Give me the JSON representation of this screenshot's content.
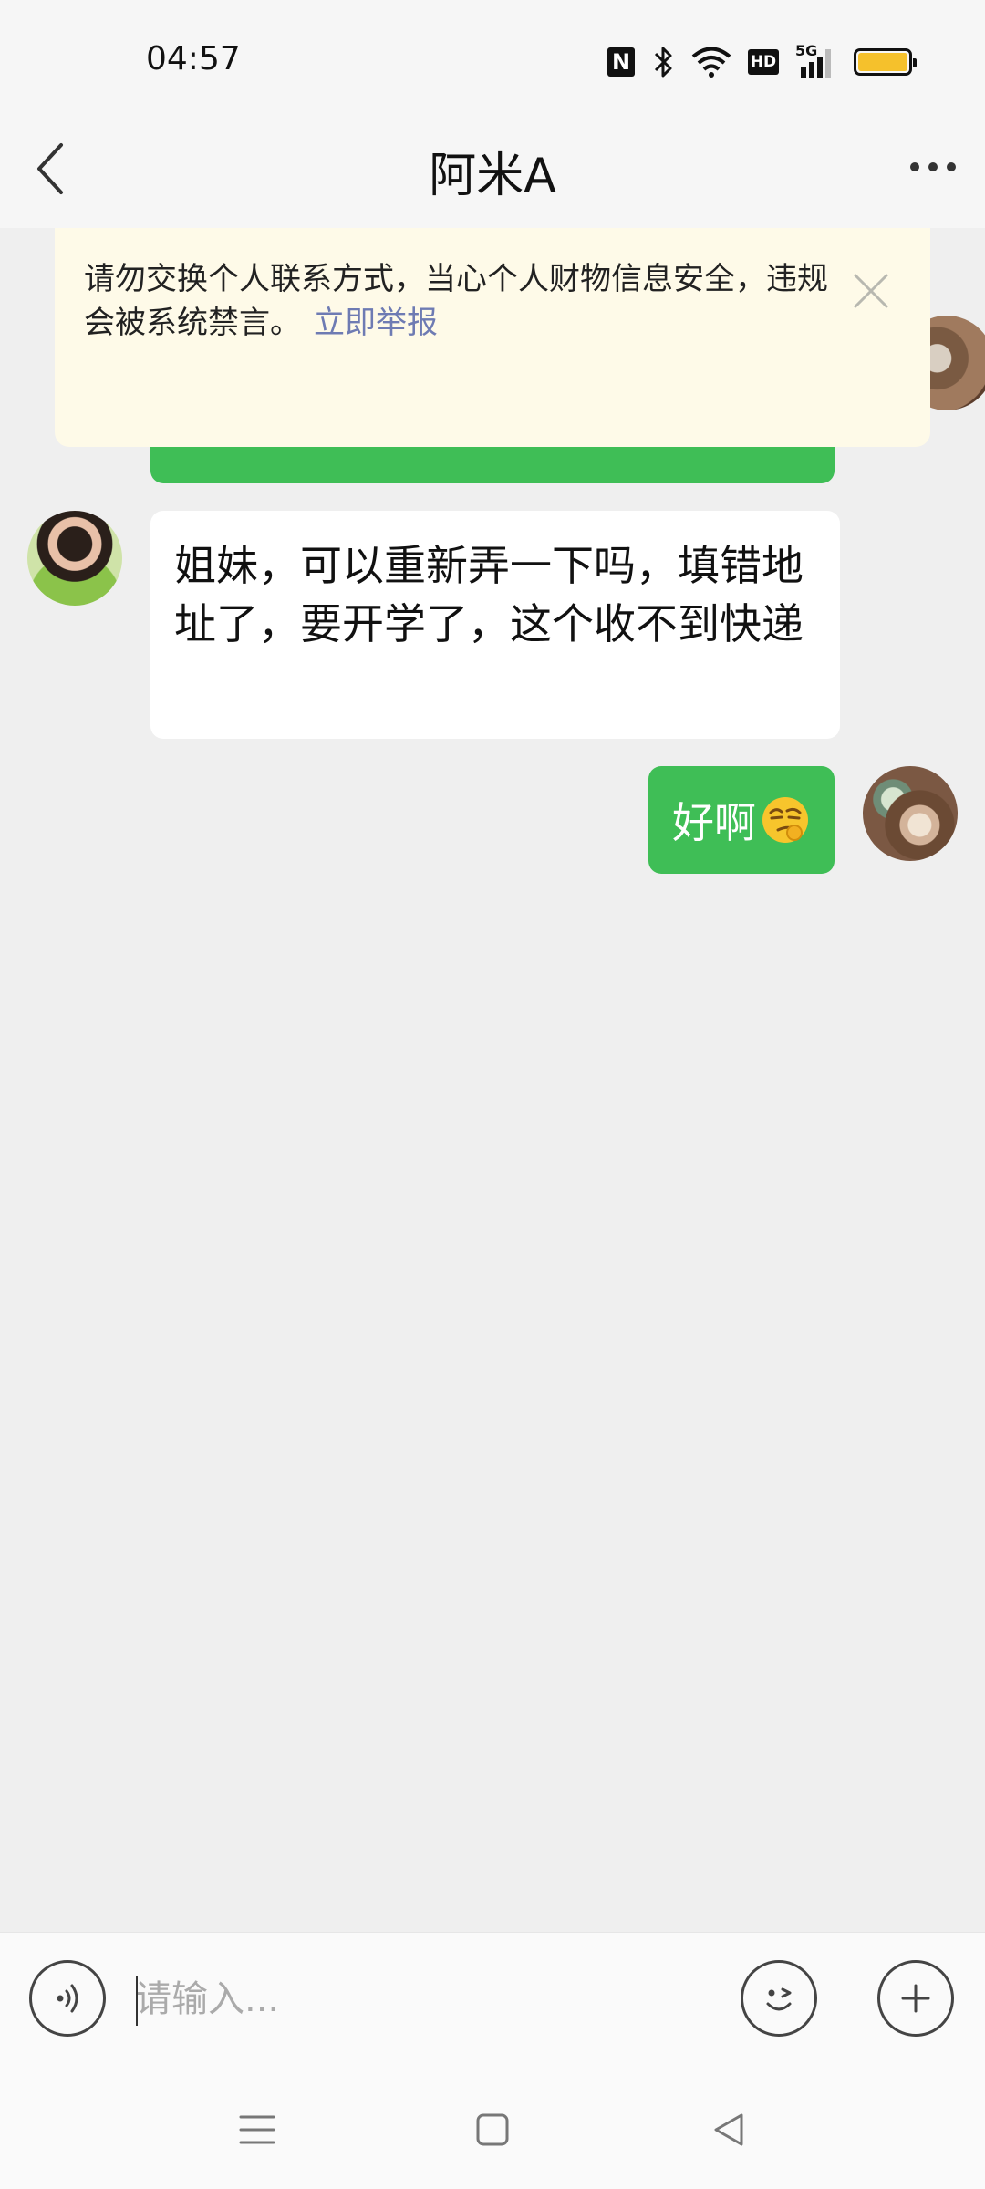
{
  "status_bar": {
    "time": "04:57",
    "nfc_label": "N",
    "hd_label": "HD",
    "network_label": "5G",
    "battery_color": "#f5c12c"
  },
  "header": {
    "title": "阿米A",
    "back_icon": "chevron-left-icon",
    "more_icon": "more-dots-icon"
  },
  "notice": {
    "text": "请勿交换个人联系方式，当心个人财物信息安全，违规会被系统禁言。",
    "link_label": "立即举报",
    "link_color": "#6e7bb3",
    "close_icon": "close-icon"
  },
  "messages": [
    {
      "sender": "self",
      "text": "",
      "partially_hidden": true
    },
    {
      "sender": "other",
      "text": "姐妹，可以重新弄一下吗，填错地址了，要开学了，这个收不到快递"
    },
    {
      "sender": "self",
      "text": "好啊",
      "emoji": "smirk-emoji"
    }
  ],
  "colors": {
    "self_bubble": "#3fbe56",
    "other_bubble": "#ffffff",
    "background": "#efefef"
  },
  "input_bar": {
    "placeholder": "请输入...",
    "value": "",
    "voice_icon": "voice-icon",
    "emoji_icon": "emoji-face-icon",
    "plus_icon": "plus-icon"
  },
  "nav_bar": {
    "menu_icon": "menu-icon",
    "home_icon": "home-square-icon",
    "back_icon": "back-triangle-icon"
  }
}
